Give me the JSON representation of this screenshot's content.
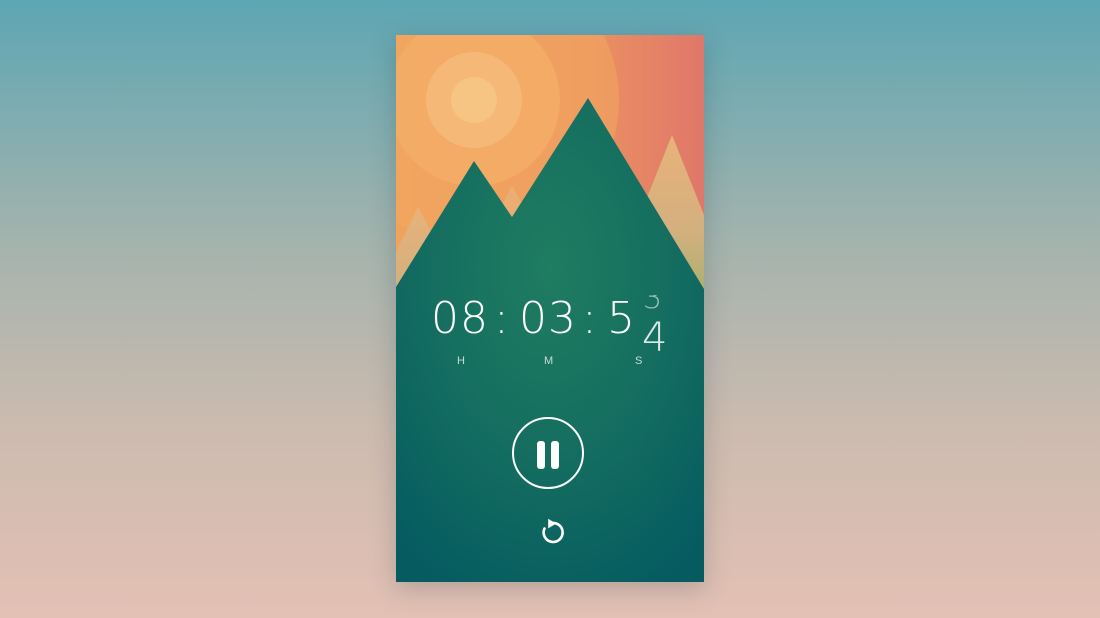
{
  "timer": {
    "hours": "08",
    "minutes": "03",
    "seconds_tens": "5",
    "seconds_ones_previous": "3",
    "seconds_ones_current": "4",
    "separator": ":",
    "unit_labels": {
      "hours": "H",
      "minutes": "M",
      "seconds": "S"
    }
  },
  "controls": {
    "pause": {
      "icon": "pause-icon"
    },
    "reset": {
      "icon": "reset-icon"
    }
  },
  "colors": {
    "sky_top": "#f0a35c",
    "sun": "#f4c07f",
    "mountain": "#1c7a5e",
    "panel_bottom": "#055b60",
    "foreground": "#ffffff"
  }
}
